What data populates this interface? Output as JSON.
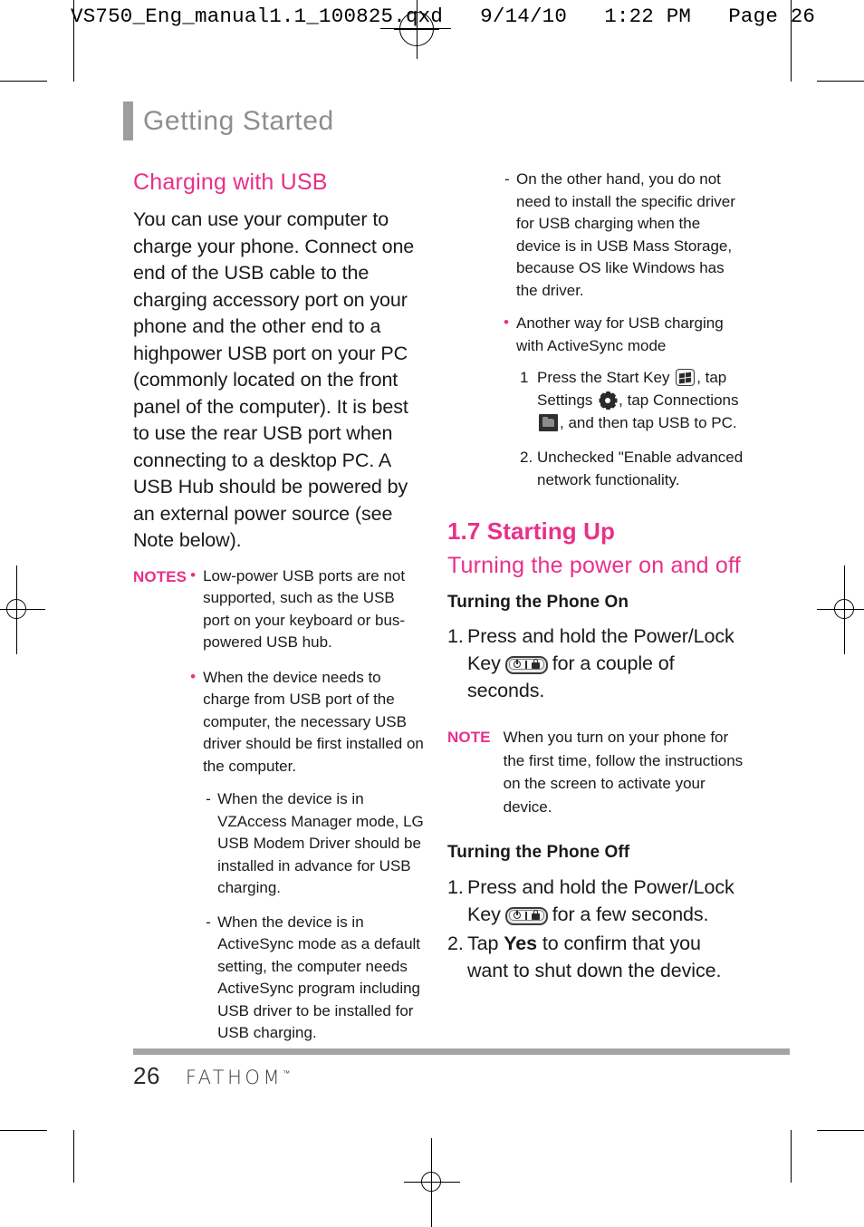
{
  "print_header": {
    "text": "VS750_Eng_manual1.1_100825.qxd   9/14/10   1:22 PM   Page 26"
  },
  "chapter": {
    "title": "Getting Started"
  },
  "left_column": {
    "section_heading": "Charging with USB",
    "intro_paragraph": "You can use your computer to charge your phone. Connect one end of the USB cable to the charging accessory port on your phone and the other end to a highpower USB port on your PC (commonly located on the front panel of the computer). It is best to use the rear USB port when connecting to a desktop PC. A USB Hub should be powered by an external power source (see Note below).",
    "notes_label": "NOTES",
    "notes": [
      "Low-power USB ports are not supported, such as the USB port on your keyboard or bus-powered USB hub.",
      "When the device needs to charge from USB port of the computer, the necessary USB driver should be first installed on the computer."
    ],
    "sub_dashes": [
      "When the device is in VZAccess Manager mode, LG USB Modem Driver should be installed in advance for USB charging.",
      "When the device is in ActiveSync mode as a default setting, the computer needs ActiveSync program including USB driver to be installed for USB charging."
    ]
  },
  "right_column": {
    "top_dash": "On the other hand, you do not need to install the specific driver for USB charging when the device is in USB Mass Storage, because OS like Windows has the driver.",
    "activesync_bullet": "Another way for USB charging with ActiveSync mode",
    "activesync_steps": [
      {
        "marker": "1",
        "part1": "Press the Start Key",
        "part2": ", tap Settings",
        "part3": ", tap Connections",
        "part4": ", and then tap USB to PC."
      },
      {
        "marker": "2.",
        "text": "Unchecked \"Enable advanced network functionality."
      }
    ],
    "section_number_heading": "1.7 Starting Up",
    "section_subheading": "Turning the power on and off",
    "phone_on_heading": "Turning the Phone On",
    "phone_on_step": {
      "num": "1.",
      "part1": "Press and hold the Power/Lock Key",
      "part2": "for a couple of seconds."
    },
    "note_label": "NOTE",
    "note_text": "When you turn on your phone for the first time, follow the instructions on the screen to activate your device.",
    "phone_off_heading": "Turning the Phone Off",
    "phone_off_step1": {
      "num": "1.",
      "part1": "Press and hold the Power/Lock Key",
      "part2": "for a few seconds."
    },
    "phone_off_step2": {
      "num": "2.",
      "part1": "Tap",
      "bold": "Yes",
      "part2": "to confirm that you want to shut down the device."
    }
  },
  "footer": {
    "page_number": "26",
    "brand": "FATHOM",
    "trademark": "™"
  },
  "colors": {
    "accent_pink": "#e8308a",
    "chapter_gray": "#8e8e8e",
    "rule_gray": "#a5a5a5"
  }
}
